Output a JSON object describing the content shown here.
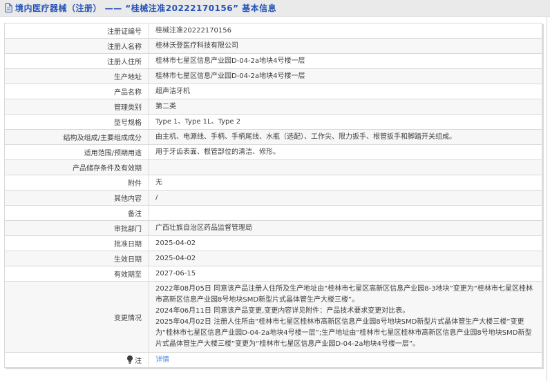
{
  "header": {
    "title": "境内医疗器械（注册） —— “桂械注准20222170156” 基本信息"
  },
  "colors": {
    "header_text": "#2351b5",
    "link": "#4a86e8",
    "row_alt": "#f7f7f7"
  },
  "table": {
    "rows": [
      {
        "label": "注册证编号",
        "value": "桂械注准20222170156"
      },
      {
        "label": "注册人名称",
        "value": "桂林沃登医疗科技有限公司"
      },
      {
        "label": "注册人住所",
        "value": "桂林市七星区信息产业园D-04-2a地块4号楼一层"
      },
      {
        "label": "生产地址",
        "value": "桂林市七星区信息产业园D-04-2a地块4号楼一层"
      },
      {
        "label": "产品名称",
        "value": "超声洁牙机"
      },
      {
        "label": "管理类别",
        "value": "第二类"
      },
      {
        "label": "型号规格",
        "value": "Type 1、Type 1L、Type 2"
      },
      {
        "label": "结构及组成/主要组成成分",
        "value": "由主机、电源线、手柄、手柄尾线、水瓶（选配）、工作尖、限力扳手、根管扳手和脚踏开关组成。"
      },
      {
        "label": "适用范围/预期用途",
        "value": "用于牙齿表面、根管部位的清洁、修形。"
      },
      {
        "label": "产品储存条件及有效期",
        "value": ""
      },
      {
        "label": "附件",
        "value": "无"
      },
      {
        "label": "其他内容",
        "value": "/"
      },
      {
        "label": "备注",
        "value": ""
      },
      {
        "label": "审批部门",
        "value": "广西壮族自治区药品监督管理局"
      },
      {
        "label": "批准日期",
        "value": "2025-04-02"
      },
      {
        "label": "生效日期",
        "value": "2025-04-02"
      },
      {
        "label": "有效期至",
        "value": "2027-06-15"
      },
      {
        "label": "变更情况",
        "paragraphs": [
          "2022年08月05日 同意该产品注册人住所及生产地址由“桂林市七星区高新区信息产业园8-3地块”变更为“桂林市七星区桂林市高新区信息产业园8号地块SMD新型片式晶体管生产大楼三楼”。",
          "2024年06月11日 同意该产品变更,变更内容详见附件：产品技术要求变更对比表。",
          "2025年04月02日 注册人住所由“桂林市七星区桂林市高新区信息产业园8号地块SMD新型片式晶体管生产大楼三楼”变更为“桂林市七星区信息产业园D-04-2a地块4号楼一层”;生产地址由“桂林市七星区桂林市高新区信息产业园8号地块SMD新型片式晶体管生产大楼三楼”变更为“桂林市七星区信息产业园D-04-2a地块4号楼一层”。"
        ]
      },
      {
        "label": "注",
        "icon": "bulb-icon",
        "link": "详情"
      }
    ]
  }
}
